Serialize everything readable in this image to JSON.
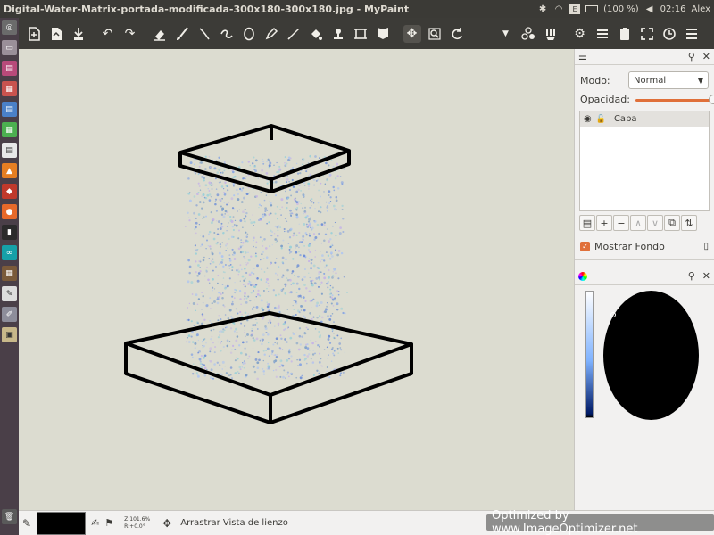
{
  "window": {
    "title": "Digital-Water-Matrix-portada-modificada-300x180-300x180.jpg - MyPaint"
  },
  "tray": {
    "battery": "(100 %)",
    "time": "02:16",
    "user": "Alex"
  },
  "launcher": {
    "items": [
      "dash",
      "files",
      "settings",
      "text",
      "doc",
      "calc",
      "impress",
      "app",
      "firefox",
      "terminal",
      "arduino",
      "image",
      "edit",
      "draw",
      "trash"
    ]
  },
  "toolbar": {
    "icons": [
      "new-file",
      "open-file",
      "save-file",
      "undo",
      "redo",
      "eraser",
      "brush",
      "ink",
      "pen",
      "ellipse",
      "pencil",
      "color-picker",
      "fill",
      "stamp",
      "frame",
      "symmetry",
      "pan",
      "zoom",
      "rotate",
      "brush-menu",
      "color-swatches",
      "brush-settings",
      "preferences",
      "layers",
      "scratchpad",
      "fullscreen",
      "history"
    ]
  },
  "layers_panel": {
    "mode_label": "Modo:",
    "mode_value": "Normal",
    "opacity_label": "Opacidad:",
    "opacity_value": 1.0,
    "layers": [
      {
        "name": "Capa",
        "visible": true,
        "locked": false,
        "selected": true
      }
    ],
    "show_background_label": "Mostrar Fondo",
    "show_background_checked": true
  },
  "status": {
    "zoom_text": "Z:101.6%",
    "rotation_text": "R:+0.0°",
    "tool_hint": "Arrastrar Vista de lienzo",
    "current_color": "#000000"
  },
  "watermark": "Optimized by www.ImageOptimizer.net",
  "colors": {
    "accent": "#e0703a",
    "canvas": "#dcdcd0",
    "toolbar": "#3c3b37"
  }
}
